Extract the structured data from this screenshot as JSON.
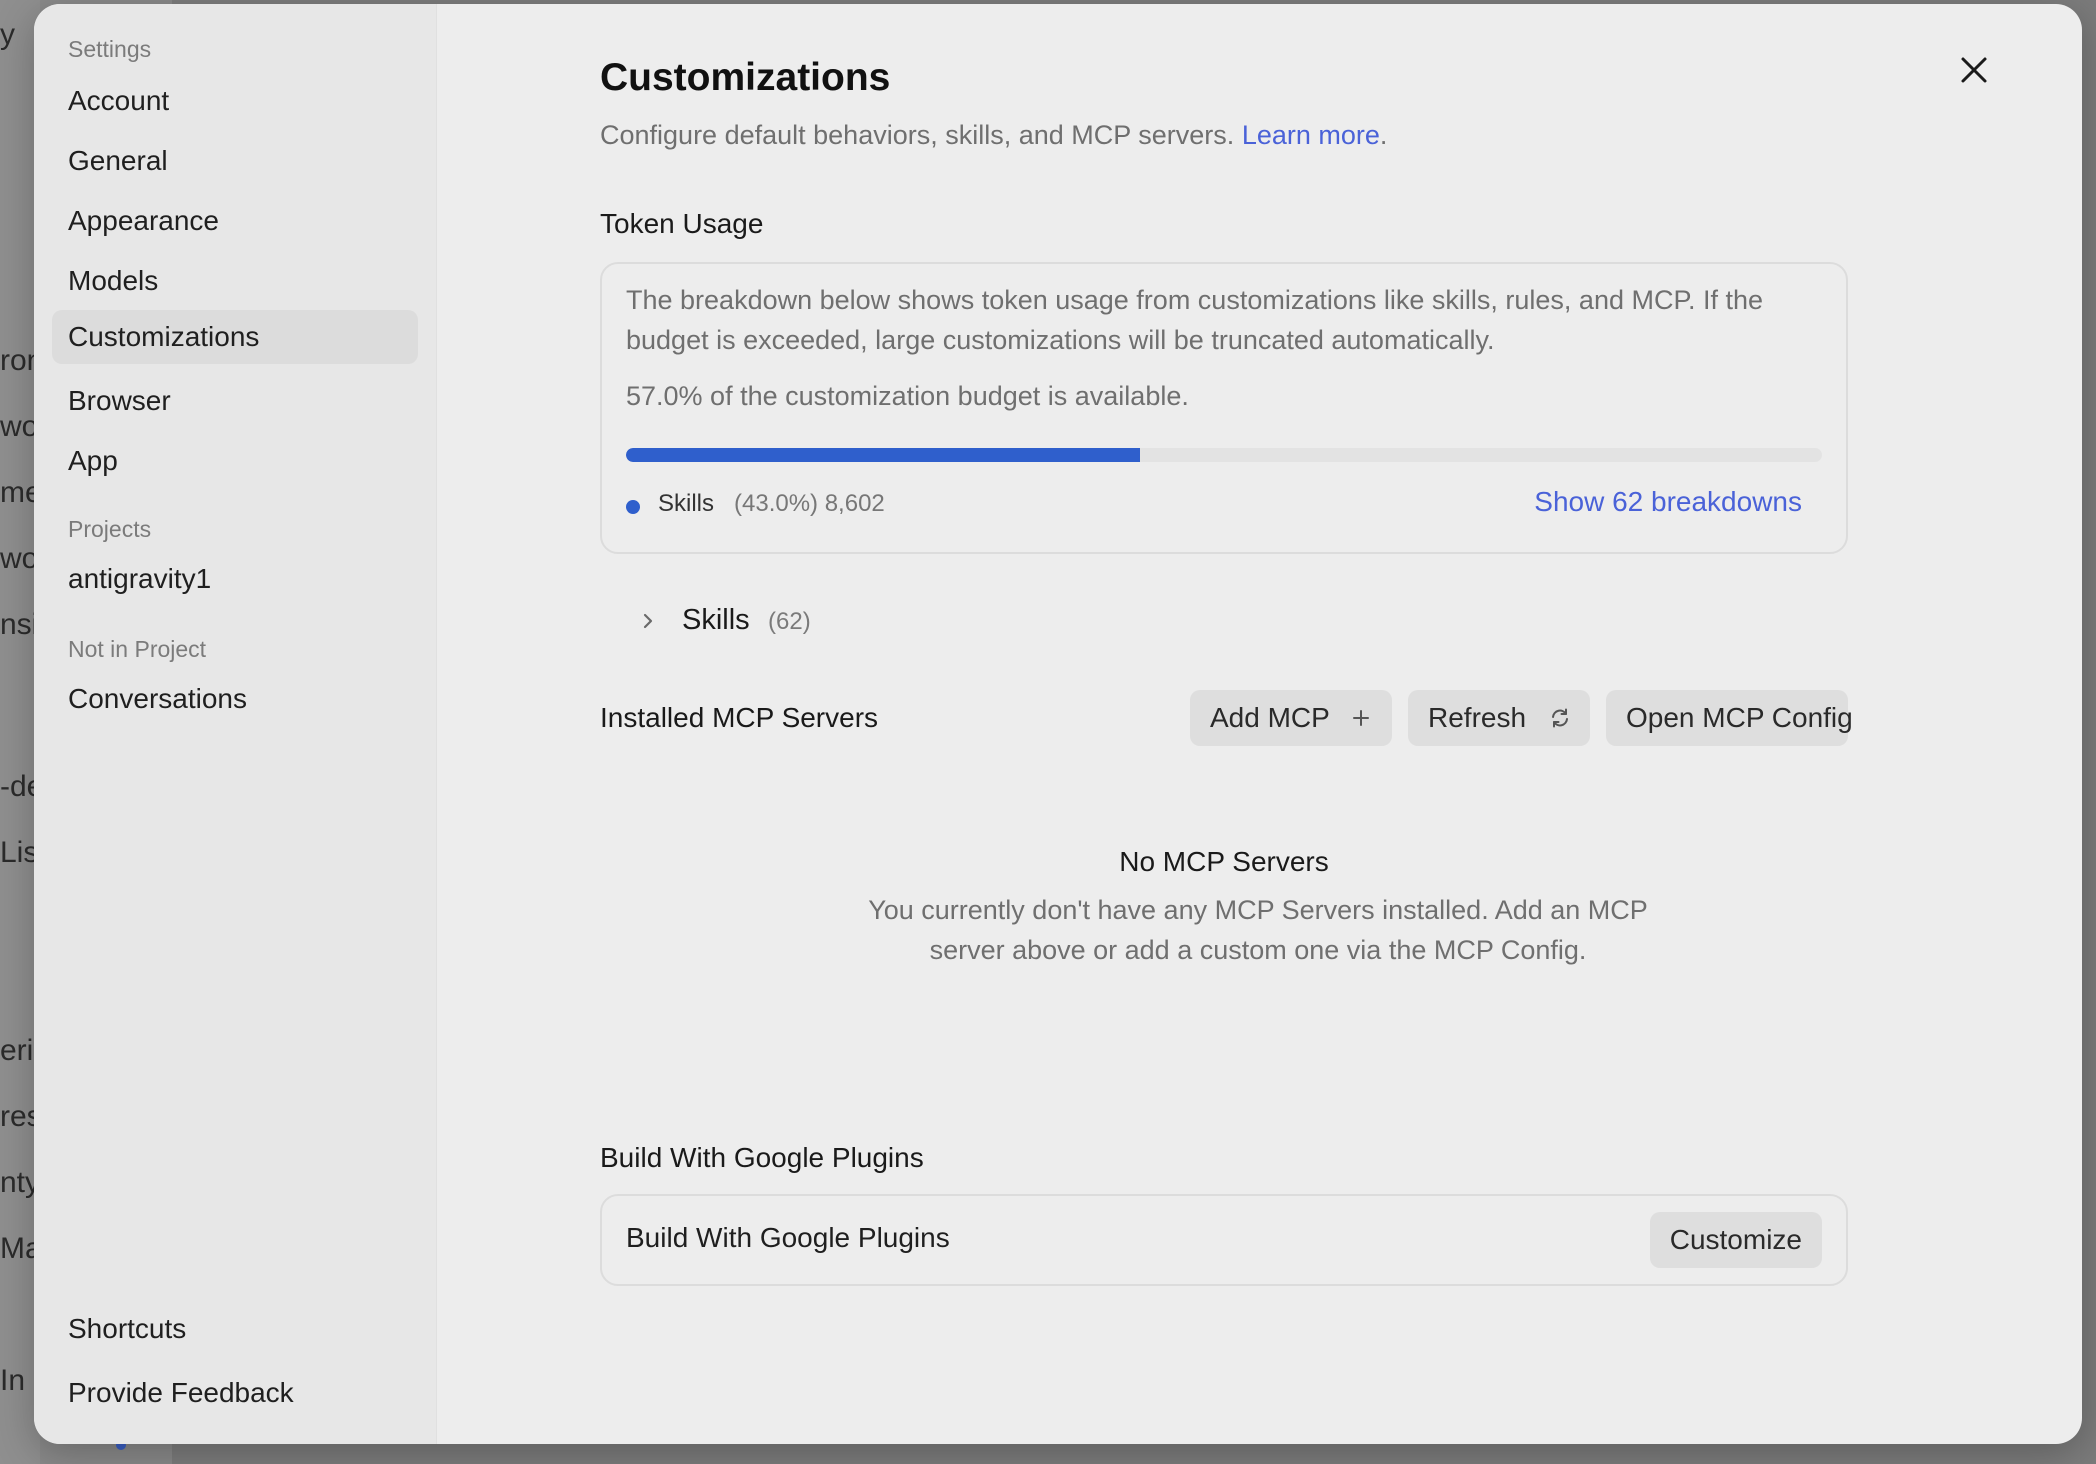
{
  "background": {
    "fragments": [
      "y",
      "ron",
      "wor",
      "men",
      "wor",
      "nsic",
      "-de",
      "Lis",
      "eril",
      "res",
      "nty",
      "Ma",
      "In I"
    ]
  },
  "sidebar": {
    "settings_heading": "Settings",
    "items": [
      {
        "label": "Account",
        "active": false
      },
      {
        "label": "General",
        "active": false
      },
      {
        "label": "Appearance",
        "active": false
      },
      {
        "label": "Models",
        "active": false
      },
      {
        "label": "Customizations",
        "active": true
      },
      {
        "label": "Browser",
        "active": false
      },
      {
        "label": "App",
        "active": false
      }
    ],
    "projects_heading": "Projects",
    "projects": [
      {
        "label": "antigravity1"
      }
    ],
    "not_in_project_heading": "Not in Project",
    "not_in_project": [
      {
        "label": "Conversations"
      }
    ],
    "footer_items": [
      {
        "label": "Shortcuts"
      },
      {
        "label": "Provide Feedback"
      }
    ]
  },
  "header": {
    "title": "Customizations",
    "subtitle": "Configure default behaviors, skills, and MCP servers.",
    "learn_more": "Learn more",
    "subtitle_end": ".",
    "close_icon": "close-icon"
  },
  "token_usage": {
    "heading": "Token Usage",
    "description": "The breakdown below shows token usage from customizations like skills, rules, and MCP. If the budget is exceeded, large customizations will be truncated automatically.",
    "available_text": "57.0% of the customization budget is available.",
    "used_fraction": 0.43,
    "bar_color": "#2f5fcc",
    "legend_name": "Skills",
    "legend_value": "(43.0%) 8,602",
    "breakdown_link": "Show 62 breakdowns"
  },
  "skills": {
    "label": "Skills",
    "count": "(62)",
    "chevron_icon": "chevron-right-icon"
  },
  "mcp": {
    "heading": "Installed MCP Servers",
    "add_label": "Add MCP",
    "add_icon": "plus-icon",
    "refresh_label": "Refresh",
    "refresh_icon": "refresh-icon",
    "open_config_label": "Open MCP Config",
    "empty_title": "No MCP Servers",
    "empty_description": "You currently don't have any MCP Servers installed. Add an MCP server above or add a custom one via the MCP Config."
  },
  "plugins": {
    "heading": "Build With Google Plugins",
    "card_label": "Build With Google Plugins",
    "customize_label": "Customize"
  },
  "colors": {
    "accent": "#4a62d8",
    "progress": "#2f5fcc",
    "modal_bg": "#ededed",
    "sidebar_bg": "#e7e7e7"
  }
}
